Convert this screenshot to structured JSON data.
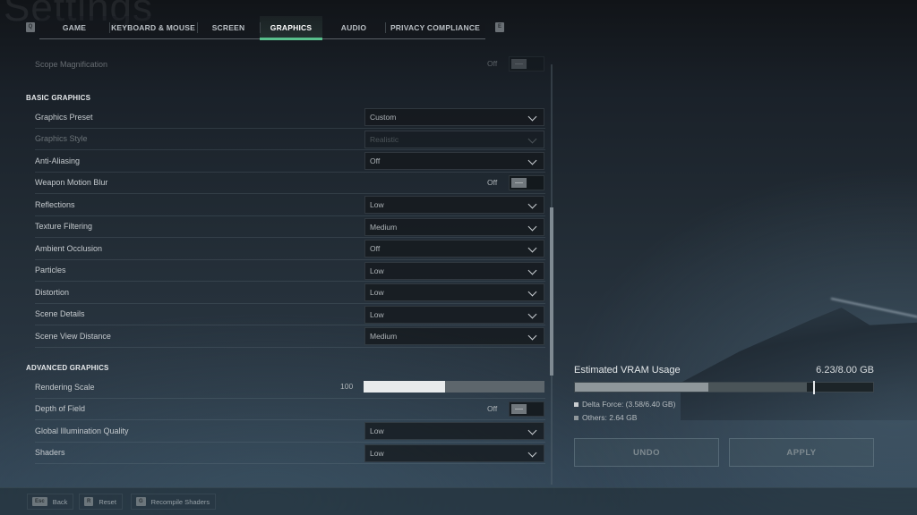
{
  "page": {
    "watermark_title": "Settings"
  },
  "tabs": {
    "prev_key": "Q",
    "next_key": "E",
    "items": [
      {
        "label": "GAME",
        "active": false
      },
      {
        "label": "KEYBOARD & MOUSE",
        "active": false
      },
      {
        "label": "SCREEN",
        "active": false
      },
      {
        "label": "GRAPHICS",
        "active": true
      },
      {
        "label": "AUDIO",
        "active": false
      },
      {
        "label": "PRIVACY COMPLIANCE",
        "active": false
      }
    ]
  },
  "settings": {
    "partial_row": {
      "label": "Scope Magnification",
      "type": "toggle",
      "value": "Off"
    },
    "basic_title": "BASIC GRAPHICS",
    "basic": [
      {
        "label": "Graphics Preset",
        "type": "dropdown",
        "value": "Custom"
      },
      {
        "label": "Graphics Style",
        "type": "dropdown",
        "value": "Realistic",
        "disabled": true
      },
      {
        "label": "Anti-Aliasing",
        "type": "dropdown",
        "value": "Off"
      },
      {
        "label": "Weapon Motion Blur",
        "type": "toggle",
        "value": "Off"
      },
      {
        "label": "Reflections",
        "type": "dropdown",
        "value": "Low"
      },
      {
        "label": "Texture Filtering",
        "type": "dropdown",
        "value": "Medium"
      },
      {
        "label": "Ambient Occlusion",
        "type": "dropdown",
        "value": "Off"
      },
      {
        "label": "Particles",
        "type": "dropdown",
        "value": "Low"
      },
      {
        "label": "Distortion",
        "type": "dropdown",
        "value": "Low"
      },
      {
        "label": "Scene Details",
        "type": "dropdown",
        "value": "Low"
      },
      {
        "label": "Scene View Distance",
        "type": "dropdown",
        "value": "Medium"
      }
    ],
    "advanced_title": "ADVANCED GRAPHICS",
    "advanced": [
      {
        "label": "Rendering Scale",
        "type": "slider",
        "value": "100",
        "fraction": 0.45
      },
      {
        "label": "Depth of Field",
        "type": "toggle",
        "value": "Off"
      },
      {
        "label": "Global Illumination Quality",
        "type": "dropdown",
        "value": "Low"
      },
      {
        "label": "Shaders",
        "type": "dropdown",
        "value": "Low"
      }
    ],
    "scroll_fraction": {
      "start": 0.34,
      "end": 0.74
    }
  },
  "vram": {
    "title": "Estimated VRAM Usage",
    "total_label": "6.23/8.00 GB",
    "capacity_gb": 8.0,
    "game_gb": 3.58,
    "others_gb": 2.64,
    "game_budget_gb": 6.4,
    "legend_game": "Delta Force: (3.58/6.40 GB)",
    "legend_others": "Others: 2.64 GB",
    "colors": {
      "game": "#8f979b",
      "others": "#4a5458",
      "marker": "#e6e9eb"
    }
  },
  "actions": {
    "undo": "UNDO",
    "apply": "APPLY"
  },
  "footer": [
    {
      "key": "Esc",
      "label": "Back"
    },
    {
      "key": "R",
      "label": "Reset"
    },
    {
      "key": "G",
      "label": "Recompile Shaders"
    }
  ]
}
